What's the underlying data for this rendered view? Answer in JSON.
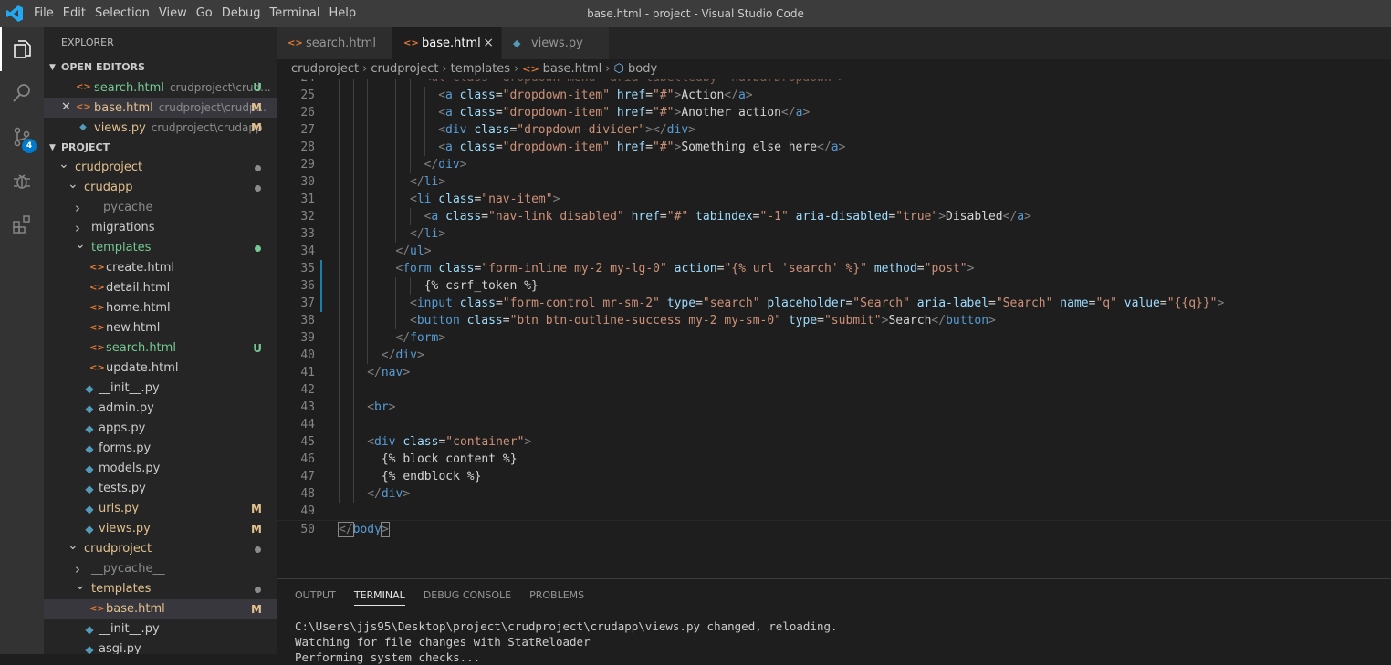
{
  "menu": [
    "File",
    "Edit",
    "Selection",
    "View",
    "Go",
    "Debug",
    "Terminal",
    "Help"
  ],
  "window_title": "base.html - project - Visual Studio Code",
  "activity": {
    "scm_badge": "4"
  },
  "explorer": {
    "title": "EXPLORER",
    "open_editors_title": "OPEN EDITORS",
    "open_editors": [
      {
        "name": "search.html",
        "path": "crudproject\\crud...",
        "status": "U",
        "type": "html"
      },
      {
        "name": "base.html",
        "path": "crudproject\\crudp...",
        "status": "M",
        "type": "html"
      },
      {
        "name": "views.py",
        "path": "crudproject\\crudapp",
        "status": "M",
        "type": "py"
      }
    ],
    "project_title": "PROJECT",
    "tree": [
      {
        "name": "crudproject",
        "kind": "folder",
        "level": 0,
        "dot": "#8b8b8b",
        "color": "#e2c08d"
      },
      {
        "name": "crudapp",
        "kind": "folder",
        "level": 1,
        "dot": "#8b8b8b",
        "color": "#e2c08d"
      },
      {
        "name": "__pycache__",
        "kind": "folder-closed",
        "level": 2,
        "color": "#8b8b8b"
      },
      {
        "name": "migrations",
        "kind": "folder-closed",
        "level": 2,
        "color": "#cccccc"
      },
      {
        "name": "templates",
        "kind": "folder",
        "level": 2,
        "dot": "#73c991",
        "color": "#73c991"
      },
      {
        "name": "create.html",
        "kind": "html",
        "level": 3,
        "color": "#cccccc"
      },
      {
        "name": "detail.html",
        "kind": "html",
        "level": 3,
        "color": "#cccccc"
      },
      {
        "name": "home.html",
        "kind": "html",
        "level": 3,
        "color": "#cccccc"
      },
      {
        "name": "new.html",
        "kind": "html",
        "level": 3,
        "color": "#cccccc"
      },
      {
        "name": "search.html",
        "kind": "html",
        "level": 3,
        "status": "U",
        "color": "#73c991"
      },
      {
        "name": "update.html",
        "kind": "html",
        "level": 3,
        "color": "#cccccc"
      },
      {
        "name": "__init__.py",
        "kind": "py",
        "level": 2,
        "color": "#cccccc"
      },
      {
        "name": "admin.py",
        "kind": "py",
        "level": 2,
        "color": "#cccccc"
      },
      {
        "name": "apps.py",
        "kind": "py",
        "level": 2,
        "color": "#cccccc"
      },
      {
        "name": "forms.py",
        "kind": "py",
        "level": 2,
        "color": "#cccccc"
      },
      {
        "name": "models.py",
        "kind": "py",
        "level": 2,
        "color": "#cccccc"
      },
      {
        "name": "tests.py",
        "kind": "py",
        "level": 2,
        "color": "#cccccc"
      },
      {
        "name": "urls.py",
        "kind": "py",
        "level": 2,
        "status": "M",
        "color": "#e2c08d"
      },
      {
        "name": "views.py",
        "kind": "py",
        "level": 2,
        "status": "M",
        "color": "#e2c08d"
      },
      {
        "name": "crudproject",
        "kind": "folder",
        "level": 1,
        "dot": "#8b8b8b",
        "color": "#e2c08d"
      },
      {
        "name": "__pycache__",
        "kind": "folder-closed",
        "level": 2,
        "color": "#8b8b8b"
      },
      {
        "name": "templates",
        "kind": "folder",
        "level": 2,
        "dot": "#8b8b8b",
        "color": "#e2c08d"
      },
      {
        "name": "base.html",
        "kind": "html",
        "level": 3,
        "status": "M",
        "color": "#e2c08d",
        "selected": true
      },
      {
        "name": "__init__.py",
        "kind": "py",
        "level": 2,
        "color": "#cccccc"
      },
      {
        "name": "asgi.py",
        "kind": "py",
        "level": 2,
        "color": "#cccccc"
      }
    ]
  },
  "tabs": [
    {
      "name": "search.html",
      "type": "html",
      "active": false,
      "width": 127
    },
    {
      "name": "base.html",
      "type": "html",
      "active": true,
      "width": 120
    },
    {
      "name": "views.py",
      "type": "py",
      "active": false,
      "width": 118
    }
  ],
  "tab_close": "×",
  "breadcrumb": [
    "crudproject",
    "crudproject",
    "templates",
    "base.html",
    "body"
  ],
  "code_lines": [
    {
      "n": "24",
      "i": 6,
      "tokens": [
        [
          "t",
          "<ul class=\"dropdown-menu\" aria-labelledby=\"navbarDropdown\">"
        ]
      ],
      "partial": true
    },
    {
      "n": "25",
      "i": 7,
      "tokens": [
        [
          "b",
          "<"
        ],
        [
          "g",
          "a"
        ],
        [
          "a",
          " class"
        ],
        [
          "t",
          "="
        ],
        [
          "s",
          "\"dropdown-item\""
        ],
        [
          "a",
          " href"
        ],
        [
          "t",
          "="
        ],
        [
          "s",
          "\"#\""
        ],
        [
          "b",
          ">"
        ],
        [
          "t",
          "Action"
        ],
        [
          "b",
          "</"
        ],
        [
          "g",
          "a"
        ],
        [
          "b",
          ">"
        ]
      ]
    },
    {
      "n": "26",
      "i": 7,
      "tokens": [
        [
          "b",
          "<"
        ],
        [
          "g",
          "a"
        ],
        [
          "a",
          " class"
        ],
        [
          "t",
          "="
        ],
        [
          "s",
          "\"dropdown-item\""
        ],
        [
          "a",
          " href"
        ],
        [
          "t",
          "="
        ],
        [
          "s",
          "\"#\""
        ],
        [
          "b",
          ">"
        ],
        [
          "t",
          "Another action"
        ],
        [
          "b",
          "</"
        ],
        [
          "g",
          "a"
        ],
        [
          "b",
          ">"
        ]
      ]
    },
    {
      "n": "27",
      "i": 7,
      "tokens": [
        [
          "b",
          "<"
        ],
        [
          "g",
          "div"
        ],
        [
          "a",
          " class"
        ],
        [
          "t",
          "="
        ],
        [
          "s",
          "\"dropdown-divider\""
        ],
        [
          "b",
          "></"
        ],
        [
          "g",
          "div"
        ],
        [
          "b",
          ">"
        ]
      ]
    },
    {
      "n": "28",
      "i": 7,
      "tokens": [
        [
          "b",
          "<"
        ],
        [
          "g",
          "a"
        ],
        [
          "a",
          " class"
        ],
        [
          "t",
          "="
        ],
        [
          "s",
          "\"dropdown-item\""
        ],
        [
          "a",
          " href"
        ],
        [
          "t",
          "="
        ],
        [
          "s",
          "\"#\""
        ],
        [
          "b",
          ">"
        ],
        [
          "t",
          "Something else here"
        ],
        [
          "b",
          "</"
        ],
        [
          "g",
          "a"
        ],
        [
          "b",
          ">"
        ]
      ]
    },
    {
      "n": "29",
      "i": 6,
      "tokens": [
        [
          "b",
          "</"
        ],
        [
          "g",
          "div"
        ],
        [
          "b",
          ">"
        ]
      ]
    },
    {
      "n": "30",
      "i": 5,
      "tokens": [
        [
          "b",
          "</"
        ],
        [
          "g",
          "li"
        ],
        [
          "b",
          ">"
        ]
      ]
    },
    {
      "n": "31",
      "i": 5,
      "tokens": [
        [
          "b",
          "<"
        ],
        [
          "g",
          "li"
        ],
        [
          "a",
          " class"
        ],
        [
          "t",
          "="
        ],
        [
          "s",
          "\"nav-item\""
        ],
        [
          "b",
          ">"
        ]
      ]
    },
    {
      "n": "32",
      "i": 6,
      "tokens": [
        [
          "b",
          "<"
        ],
        [
          "g",
          "a"
        ],
        [
          "a",
          " class"
        ],
        [
          "t",
          "="
        ],
        [
          "s",
          "\"nav-link disabled\""
        ],
        [
          "a",
          " href"
        ],
        [
          "t",
          "="
        ],
        [
          "s",
          "\"#\""
        ],
        [
          "a",
          " tabindex"
        ],
        [
          "t",
          "="
        ],
        [
          "s",
          "\"-1\""
        ],
        [
          "a",
          " aria-disabled"
        ],
        [
          "t",
          "="
        ],
        [
          "s",
          "\"true\""
        ],
        [
          "b",
          ">"
        ],
        [
          "t",
          "Disabled"
        ],
        [
          "b",
          "</"
        ],
        [
          "g",
          "a"
        ],
        [
          "b",
          ">"
        ]
      ]
    },
    {
      "n": "33",
      "i": 5,
      "tokens": [
        [
          "b",
          "</"
        ],
        [
          "g",
          "li"
        ],
        [
          "b",
          ">"
        ]
      ]
    },
    {
      "n": "34",
      "i": 4,
      "tokens": [
        [
          "b",
          "</"
        ],
        [
          "g",
          "ul"
        ],
        [
          "b",
          ">"
        ]
      ]
    },
    {
      "n": "35",
      "i": 4,
      "tokens": [
        [
          "b",
          "<"
        ],
        [
          "g",
          "form"
        ],
        [
          "a",
          " class"
        ],
        [
          "t",
          "="
        ],
        [
          "s",
          "\"form-inline my-2 my-lg-0\""
        ],
        [
          "a",
          " action"
        ],
        [
          "t",
          "="
        ],
        [
          "s",
          "\"{% url 'search' %}\""
        ],
        [
          "a",
          " method"
        ],
        [
          "t",
          "="
        ],
        [
          "s",
          "\"post\""
        ],
        [
          "b",
          ">"
        ]
      ],
      "mod": true
    },
    {
      "n": "36",
      "i": 6,
      "tokens": [
        [
          "t",
          "{% csrf_token %}"
        ]
      ],
      "mod": true
    },
    {
      "n": "37",
      "i": 5,
      "tokens": [
        [
          "b",
          "<"
        ],
        [
          "g",
          "input"
        ],
        [
          "a",
          " class"
        ],
        [
          "t",
          "="
        ],
        [
          "s",
          "\"form-control mr-sm-2\""
        ],
        [
          "a",
          " type"
        ],
        [
          "t",
          "="
        ],
        [
          "s",
          "\"search\""
        ],
        [
          "a",
          " placeholder"
        ],
        [
          "t",
          "="
        ],
        [
          "s",
          "\"Search\""
        ],
        [
          "a",
          " aria-label"
        ],
        [
          "t",
          "="
        ],
        [
          "s",
          "\"Search\""
        ],
        [
          "a",
          " name"
        ],
        [
          "t",
          "="
        ],
        [
          "s",
          "\"q\""
        ],
        [
          "a",
          " value"
        ],
        [
          "t",
          "="
        ],
        [
          "s",
          "\"{{q}}\""
        ],
        [
          "b",
          ">"
        ]
      ],
      "mod": true
    },
    {
      "n": "38",
      "i": 5,
      "tokens": [
        [
          "b",
          "<"
        ],
        [
          "g",
          "button"
        ],
        [
          "a",
          " class"
        ],
        [
          "t",
          "="
        ],
        [
          "s",
          "\"btn btn-outline-success my-2 my-sm-0\""
        ],
        [
          "a",
          " type"
        ],
        [
          "t",
          "="
        ],
        [
          "s",
          "\"submit\""
        ],
        [
          "b",
          ">"
        ],
        [
          "t",
          "Search"
        ],
        [
          "b",
          "</"
        ],
        [
          "g",
          "button"
        ],
        [
          "b",
          ">"
        ]
      ]
    },
    {
      "n": "39",
      "i": 4,
      "tokens": [
        [
          "b",
          "</"
        ],
        [
          "g",
          "form"
        ],
        [
          "b",
          ">"
        ]
      ]
    },
    {
      "n": "40",
      "i": 3,
      "tokens": [
        [
          "b",
          "</"
        ],
        [
          "g",
          "div"
        ],
        [
          "b",
          ">"
        ]
      ]
    },
    {
      "n": "41",
      "i": 2,
      "tokens": [
        [
          "b",
          "</"
        ],
        [
          "g",
          "nav"
        ],
        [
          "b",
          ">"
        ]
      ]
    },
    {
      "n": "42",
      "i": 2,
      "tokens": []
    },
    {
      "n": "43",
      "i": 2,
      "tokens": [
        [
          "b",
          "<"
        ],
        [
          "g",
          "br"
        ],
        [
          "b",
          ">"
        ]
      ]
    },
    {
      "n": "44",
      "i": 2,
      "tokens": []
    },
    {
      "n": "45",
      "i": 2,
      "tokens": [
        [
          "b",
          "<"
        ],
        [
          "g",
          "div"
        ],
        [
          "a",
          " class"
        ],
        [
          "t",
          "="
        ],
        [
          "s",
          "\"container\""
        ],
        [
          "b",
          ">"
        ]
      ]
    },
    {
      "n": "46",
      "i": 2,
      "tokens": [
        [
          "t",
          "  {% block content %}"
        ]
      ]
    },
    {
      "n": "47",
      "i": 2,
      "tokens": [
        [
          "t",
          "  {% endblock %}"
        ]
      ]
    },
    {
      "n": "48",
      "i": 2,
      "tokens": [
        [
          "b",
          "</"
        ],
        [
          "g",
          "div"
        ],
        [
          "b",
          ">"
        ]
      ]
    },
    {
      "n": "49",
      "i": 0,
      "tokens": []
    },
    {
      "n": "50",
      "i": 0,
      "tokens": [
        [
          "b",
          "</"
        ],
        [
          "g",
          "body"
        ],
        [
          "b",
          ">"
        ]
      ],
      "cursor": true
    }
  ],
  "panel": {
    "tabs": [
      "OUTPUT",
      "TERMINAL",
      "DEBUG CONSOLE",
      "PROBLEMS"
    ],
    "active_tab": "TERMINAL",
    "terminal_lines": [
      "C:\\Users\\jjs95\\Desktop\\project\\crudproject\\crudapp\\views.py changed, reloading.",
      "Watching for file changes with StatReloader",
      "Performing system checks..."
    ]
  },
  "colors": {
    "accent": "#007acc",
    "modified": "#e2c08d",
    "untracked": "#73c991",
    "html_icon": "#e37933",
    "py_icon": "#519aba"
  }
}
